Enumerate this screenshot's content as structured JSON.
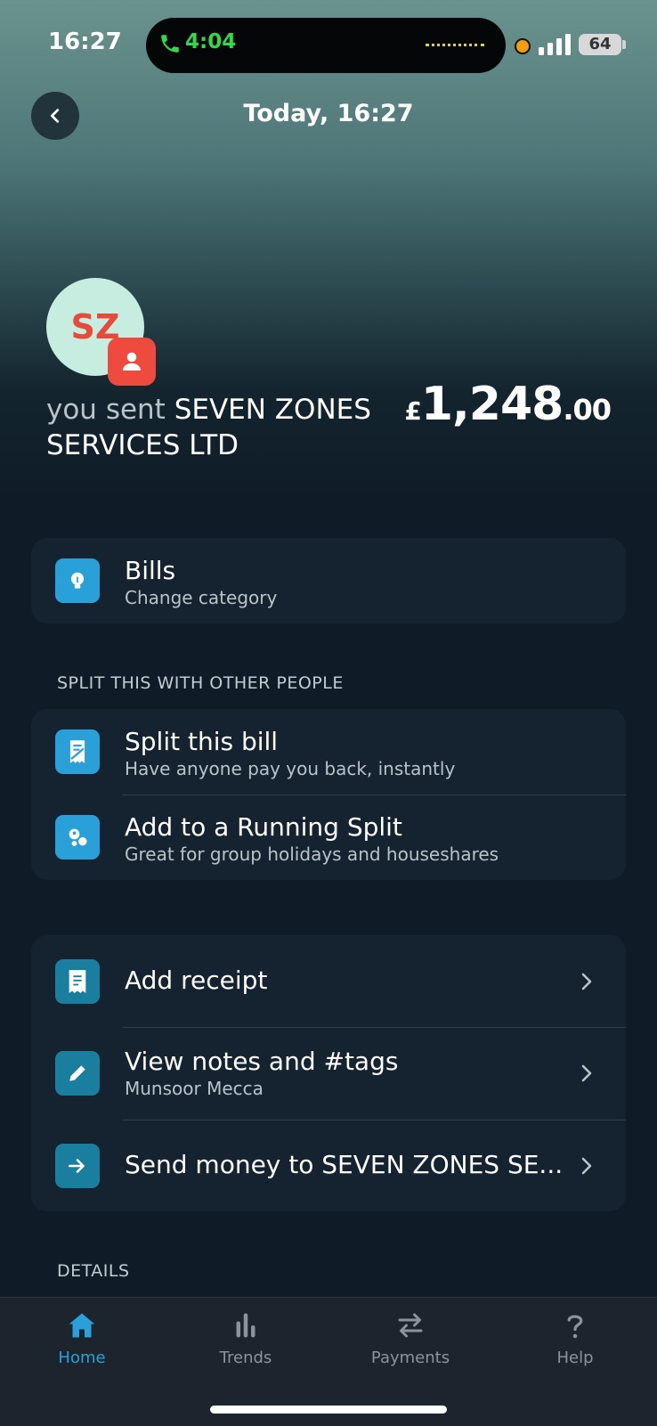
{
  "status_bar": {
    "time": "16:27",
    "call_timer": "4:04",
    "battery": "64"
  },
  "header": {
    "title": "Today, 16:27"
  },
  "transaction": {
    "avatar_initials": "SZ",
    "prefix": "you sent",
    "merchant": "SEVEN ZONES SERVICES LTD",
    "currency": "£",
    "amount_major": "1,248",
    "amount_minor": ".00"
  },
  "category": {
    "title": "Bills",
    "subtitle": "Change category"
  },
  "split_section": {
    "label": "SPLIT THIS WITH OTHER PEOPLE",
    "items": [
      {
        "title": "Split this bill",
        "subtitle": "Have anyone pay you back, instantly"
      },
      {
        "title": "Add to a Running Split",
        "subtitle": "Great for group holidays and houseshares"
      }
    ]
  },
  "actions": {
    "items": [
      {
        "title": "Add receipt"
      },
      {
        "title": "View notes and #tags",
        "subtitle": "Munsoor Mecca"
      },
      {
        "title": "Send money to SEVEN ZONES SE..."
      }
    ]
  },
  "details_label": "DETAILS",
  "tabbar": {
    "items": [
      {
        "label": "Home",
        "active": true,
        "icon": "home-icon"
      },
      {
        "label": "Trends",
        "active": false,
        "icon": "bar-chart-icon"
      },
      {
        "label": "Payments",
        "active": false,
        "icon": "transfer-arrows-icon"
      },
      {
        "label": "Help",
        "active": false,
        "icon": "question-icon"
      }
    ],
    "active_color": "#2aa0d8",
    "inactive_color": "#8a949c"
  },
  "colors": {
    "accent_blue": "#2aa0d8",
    "badge_red": "#ee4a3e",
    "avatar_bg": "#c7ede0"
  }
}
